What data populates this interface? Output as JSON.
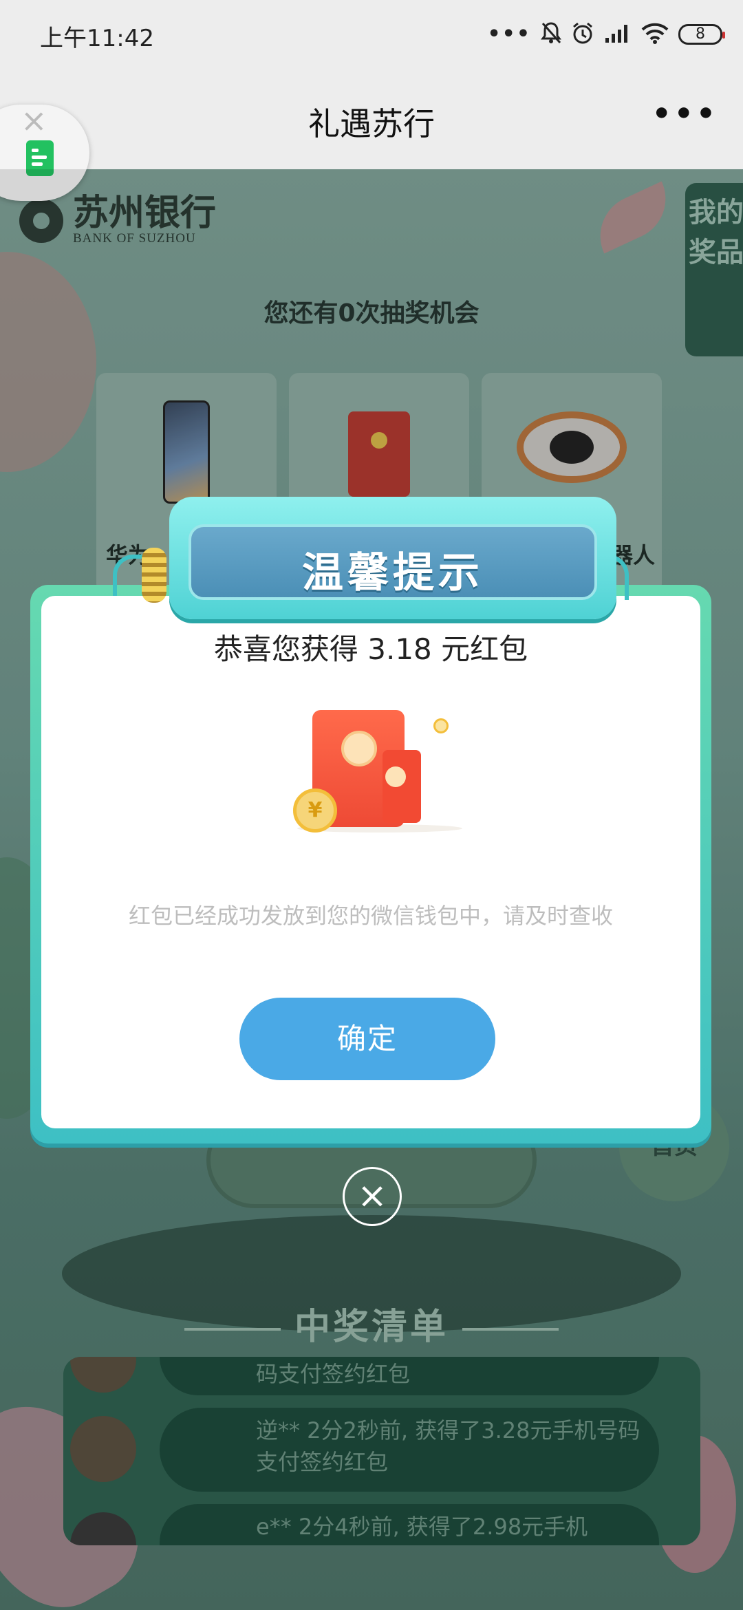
{
  "status_bar": {
    "time": "上午11:42",
    "battery": "8",
    "icons": [
      "more-dots-icon",
      "bell-muted-icon",
      "alarm-icon",
      "signal-icon",
      "wifi-icon",
      "battery-icon"
    ]
  },
  "title_bar": {
    "title": "礼遇苏行",
    "more_label": "•••"
  },
  "floating_button": {
    "close_label": "×"
  },
  "background_page": {
    "bank_name_cn": "苏州银行",
    "bank_name_en": "BANK OF SUZHOU",
    "my_prizes_tab": "我的奖品",
    "chances_text": "您还有0次抽奖机会",
    "prizes": [
      {
        "name": "华为",
        "icon": "phone-icon"
      },
      {
        "name": "",
        "icon": "red-envelope-icon"
      },
      {
        "name": "机器人",
        "icon": "robot-vacuum-icon"
      }
    ],
    "home_button": "首页",
    "winners_title": "中奖清单",
    "winners": [
      {
        "text": "码支付签约红包"
      },
      {
        "text": "逆** 2分2秒前, 获得了3.28元手机号码支付签约红包"
      },
      {
        "text": "e** 2分4秒前, 获得了2.98元手机"
      }
    ]
  },
  "modal": {
    "title": "温馨提示",
    "message": "恭喜您获得 3.18 元红包",
    "coin_symbol": "¥",
    "note": "红包已经成功发放到您的微信钱包中，请及时查收",
    "confirm_label": "确定",
    "close_label": "×"
  },
  "colors": {
    "confirm_button": "#4aa9e6",
    "modal_frame": "#3ec0c4",
    "title_banner": "#4b8fb6",
    "red_packet": "#ee4a35"
  }
}
